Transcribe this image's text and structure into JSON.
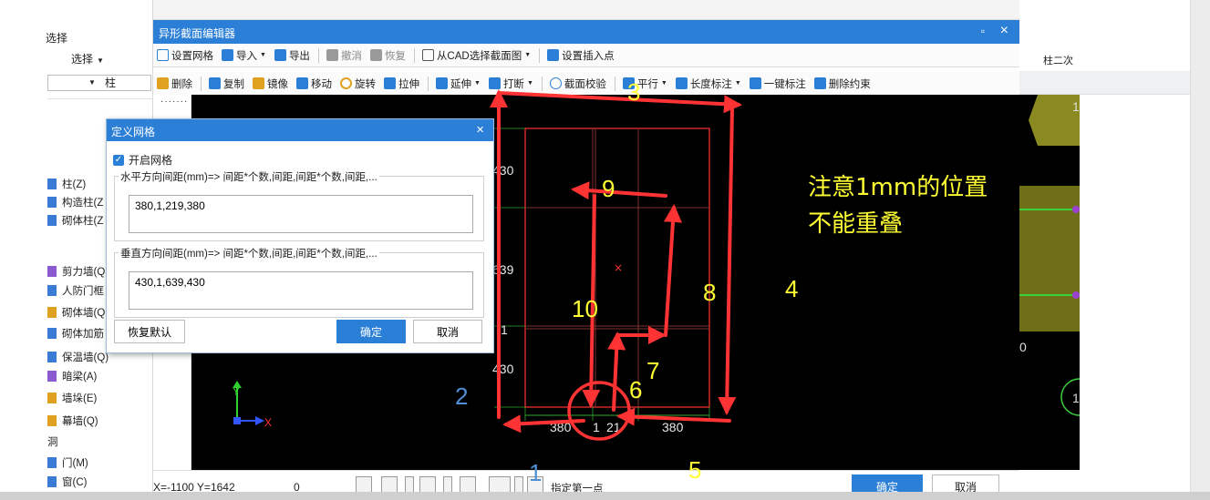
{
  "left_panel": {
    "title": "选择",
    "select_label": "选择",
    "combo_value": "柱",
    "items": [
      {
        "label": "柱(Z)",
        "color": "#3a7bd5"
      },
      {
        "label": "构造柱(Z",
        "color": "#3a7bd5"
      },
      {
        "label": "砌体柱(Z",
        "color": "#3a7bd5"
      },
      {
        "label": "剪力墙(Q",
        "color": "#8a5bd0"
      },
      {
        "label": "人防门框",
        "color": "#3a7bd5"
      },
      {
        "label": "砌体墙(Q",
        "color": "#e0a020"
      },
      {
        "label": "砌体加筋",
        "color": "#3a7bd5"
      },
      {
        "label": "保温墙(Q)",
        "color": "#3a7bd5"
      },
      {
        "label": "暗梁(A)",
        "color": "#8a5bd0"
      },
      {
        "label": "墙垛(E)",
        "color": "#e0a020"
      },
      {
        "label": "幕墙(Q)",
        "color": "#e0a020"
      },
      {
        "label": "洞",
        "color": "#ffffff"
      },
      {
        "label": "门(M)",
        "color": "#3a7bd5"
      },
      {
        "label": "窗(C)",
        "color": "#3a7bd5"
      }
    ]
  },
  "editor": {
    "title": "异形截面编辑器",
    "maximize_icon": "▫",
    "close_icon": "×",
    "toolbar1": [
      {
        "label": "设置网格",
        "icon": "grid-icon",
        "color": "#2b7fd6"
      },
      {
        "label": "导入",
        "icon": "import-icon",
        "color": "#2b7fd6",
        "dropdown": true
      },
      {
        "label": "导出",
        "icon": "export-icon",
        "color": "#2b7fd6"
      },
      {
        "label": "撤消",
        "icon": "undo-icon",
        "color": "#888888",
        "disabled": true
      },
      {
        "label": "恢复",
        "icon": "redo-icon",
        "color": "#888888",
        "disabled": true
      },
      {
        "label": "从CAD选择截面图",
        "icon": "cad-select-icon",
        "color": "#2b7fd6",
        "dropdown": true
      },
      {
        "label": "设置插入点",
        "icon": "insert-point-icon",
        "color": "#2b7fd6"
      }
    ],
    "toolbar2": [
      {
        "label": "删除",
        "icon": "delete-icon",
        "color": "#e0a020"
      },
      {
        "label": "复制",
        "icon": "copy-icon",
        "color": "#2b7fd6"
      },
      {
        "label": "镜像",
        "icon": "mirror-icon",
        "color": "#e0a020"
      },
      {
        "label": "移动",
        "icon": "move-icon",
        "color": "#2b7fd6"
      },
      {
        "label": "旋转",
        "icon": "rotate-icon",
        "color": "#e0a020"
      },
      {
        "label": "拉伸",
        "icon": "stretch-icon",
        "color": "#2b7fd6"
      },
      {
        "label": "延伸",
        "icon": "extend-icon",
        "color": "#2b7fd6",
        "dropdown": true
      },
      {
        "label": "打断",
        "icon": "break-icon",
        "color": "#2b7fd6",
        "dropdown": true
      },
      {
        "label": "截面校验",
        "icon": "check-icon",
        "color": "#2b7fd6"
      },
      {
        "label": "平行",
        "icon": "parallel-icon",
        "color": "#2b7fd6",
        "dropdown": true
      },
      {
        "label": "长度标注",
        "icon": "dimension-icon",
        "color": "#2b7fd6",
        "dropdown": true
      },
      {
        "label": "一键标注",
        "icon": "auto-dim-icon",
        "color": "#2b7fd6"
      },
      {
        "label": "删除约束",
        "icon": "remove-constraint-icon",
        "color": "#2b7fd6"
      }
    ],
    "canvas": {
      "dim_labels_vertical": [
        "430",
        "639",
        "1",
        "430"
      ],
      "dim_labels_horizontal": [
        "380",
        "1",
        "21",
        "380"
      ],
      "axis_y": "Y",
      "axis_x": "X"
    },
    "status": {
      "coords": "X=-1100 Y=1642",
      "value": "0",
      "prompt": "指定第一点",
      "ok": "确定",
      "cancel": "取消"
    }
  },
  "dialog": {
    "title": "定义网格",
    "close_icon": "×",
    "enable_grid_label": "开启网格",
    "enable_grid_checked": true,
    "horizontal_label": "水平方向间距(mm)=> 间距*个数,间距,间距*个数,间距,...",
    "horizontal_value": "380,1,219,380",
    "vertical_label": "垂直方向间距(mm)=> 间距*个数,间距,间距*个数,间距,...",
    "vertical_value": "430,1,639,430",
    "restore_label": "恢复默认",
    "ok_label": "确定",
    "cancel_label": "取消"
  },
  "right_panel": {
    "label": "柱二次",
    "canvas_numbers": [
      "1",
      "0",
      "1"
    ]
  },
  "annotations": {
    "note_line1": "注意1mm的位置",
    "note_line2": "不能重叠",
    "numbers": [
      "1",
      "2",
      "3",
      "4",
      "5",
      "6",
      "7",
      "8",
      "9",
      "10"
    ],
    "arrow_color": "#ff3333",
    "yellow": "#ffff33",
    "blue": "#4f8fd6"
  }
}
